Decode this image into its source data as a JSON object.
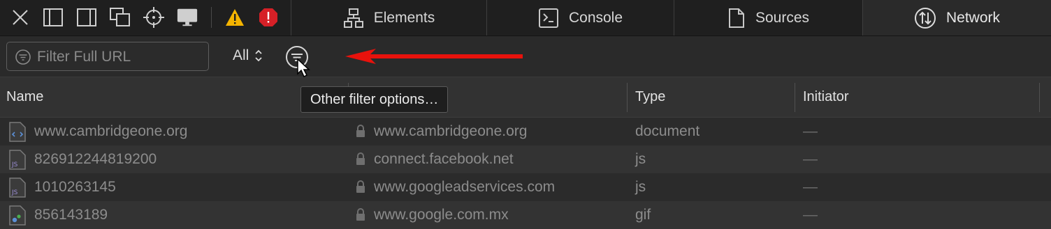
{
  "toolbar": {
    "icons": [
      "close-icon",
      "dock-left-icon",
      "dock-right-icon",
      "undock-icon",
      "element-selection-icon",
      "device-preview-icon",
      "warning-icon",
      "error-icon"
    ]
  },
  "tabs": [
    {
      "label": "Elements",
      "icon": "elements-icon",
      "active": false
    },
    {
      "label": "Console",
      "icon": "console-icon",
      "active": false
    },
    {
      "label": "Sources",
      "icon": "sources-icon",
      "active": false
    },
    {
      "label": "Network",
      "icon": "network-icon",
      "active": true
    }
  ],
  "filter": {
    "placeholder": "Filter Full URL",
    "type_select": "All"
  },
  "tooltip": "Other filter options…",
  "columns": {
    "name": "Name",
    "domain": "",
    "type": "Type",
    "initiator": "Initiator"
  },
  "rows": [
    {
      "name": "www.cambridgeone.org",
      "domain": "www.cambridgeone.org",
      "type": "document",
      "initiator": "—",
      "icon": "html-file-icon"
    },
    {
      "name": "826912244819200",
      "domain": "connect.facebook.net",
      "type": "js",
      "initiator": "—",
      "icon": "js-file-icon"
    },
    {
      "name": "1010263145",
      "domain": "www.googleadservices.com",
      "type": "js",
      "initiator": "—",
      "icon": "js-file-icon"
    },
    {
      "name": "856143189",
      "domain": "www.google.com.mx",
      "type": "gif",
      "initiator": "—",
      "icon": "image-file-icon"
    }
  ],
  "colors": {
    "annotation_arrow": "#e8120c",
    "warning": "#f5b400",
    "error": "#d62027"
  }
}
